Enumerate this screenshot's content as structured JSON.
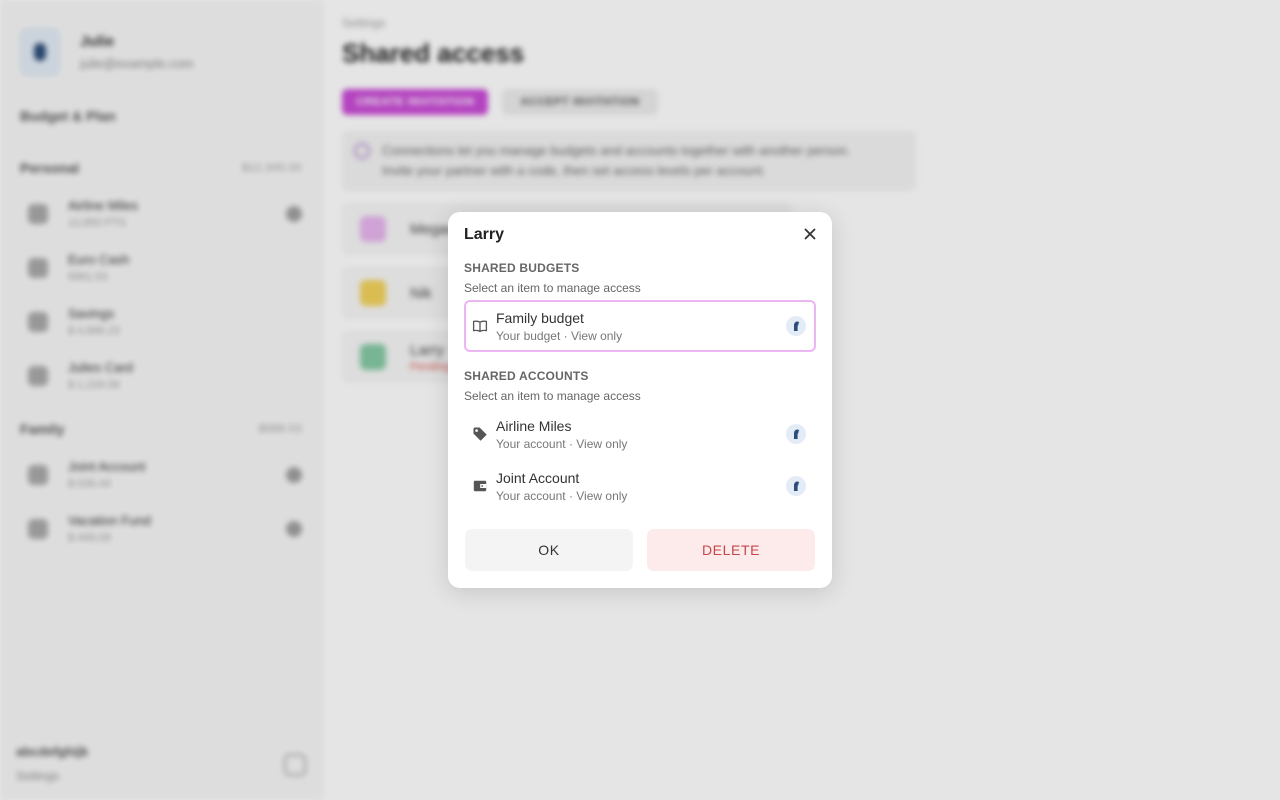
{
  "background": {
    "profile": {
      "name": "Julie",
      "email": "julie@example.com"
    },
    "sidebar_heading": "Budget & Plan",
    "groups": [
      {
        "title": "Personal",
        "total": "$12,345.00",
        "items": [
          {
            "name": "Airline Miles",
            "amount": "12,850 PTS"
          },
          {
            "name": "Euro Cash",
            "amount": "€861.53"
          },
          {
            "name": "Savings",
            "amount": "$ 4,896.23"
          },
          {
            "name": "Julies Card",
            "amount": "$ 1,234.56"
          }
        ]
      },
      {
        "title": "Family",
        "total": "$988.53",
        "items": [
          {
            "name": "Joint Account",
            "amount": "$ 539.44"
          },
          {
            "name": "Vacation Fund",
            "amount": "$ 449.09"
          }
        ]
      }
    ],
    "footer": {
      "text": "abcdefghijk",
      "sub": "Settings"
    },
    "breadcrumb": "Settings",
    "page_title": "Shared access",
    "create_label": "CREATE INVITATION",
    "accept_label": "ACCEPT INVITATION",
    "info_line1": "Connections let you manage budgets and accounts together with another person.",
    "info_line2": "Invite your partner with a code, then set access levels per account.",
    "people": [
      {
        "name": "Megan",
        "status": "",
        "color": "#e7b6ee"
      },
      {
        "name": "Nik",
        "status": "",
        "color": "#f3d35c"
      },
      {
        "name": "Larry",
        "status": "Pending",
        "color": "#86caa5"
      }
    ]
  },
  "dialog": {
    "title": "Larry",
    "budgets_title": "SHARED BUDGETS",
    "budgets_hint": "Select an item to manage access",
    "budgets": [
      {
        "name": "Family budget",
        "sub": "Your budget · View only",
        "icon": "book-icon"
      }
    ],
    "accounts_title": "SHARED ACCOUNTS",
    "accounts_hint": "Select an item to manage access",
    "accounts": [
      {
        "name": "Airline Miles",
        "sub": "Your account · View only",
        "icon": "tag-icon"
      },
      {
        "name": "Joint Account",
        "sub": "Your account · View only",
        "icon": "wallet-icon"
      }
    ],
    "ok_label": "OK",
    "delete_label": "DELETE",
    "accent_color": "#ecb6f2",
    "danger_color": "#c5474a"
  }
}
